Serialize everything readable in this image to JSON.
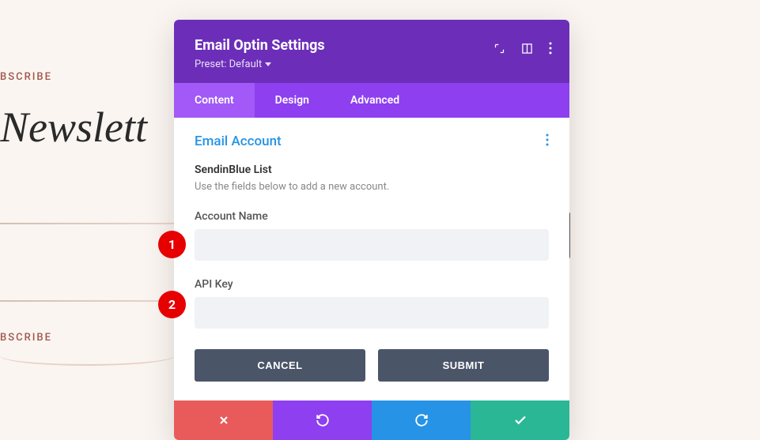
{
  "background": {
    "subscribe_label": "BSCRIBE",
    "newsletter_heading": "Newslett",
    "subscribe_label2": "BSCRIBE"
  },
  "modal": {
    "title": "Email Optin Settings",
    "preset_label": "Preset: Default",
    "tabs": {
      "content": "Content",
      "design": "Design",
      "advanced": "Advanced"
    },
    "section": {
      "title": "Email Account",
      "list_title": "SendinBlue List",
      "description": "Use the fields below to add a new account."
    },
    "fields": {
      "account_name_label": "Account Name",
      "account_name_value": "",
      "api_key_label": "API Key",
      "api_key_value": ""
    },
    "buttons": {
      "cancel": "CANCEL",
      "submit": "SUBMIT"
    }
  },
  "callouts": {
    "one": "1",
    "two": "2"
  }
}
